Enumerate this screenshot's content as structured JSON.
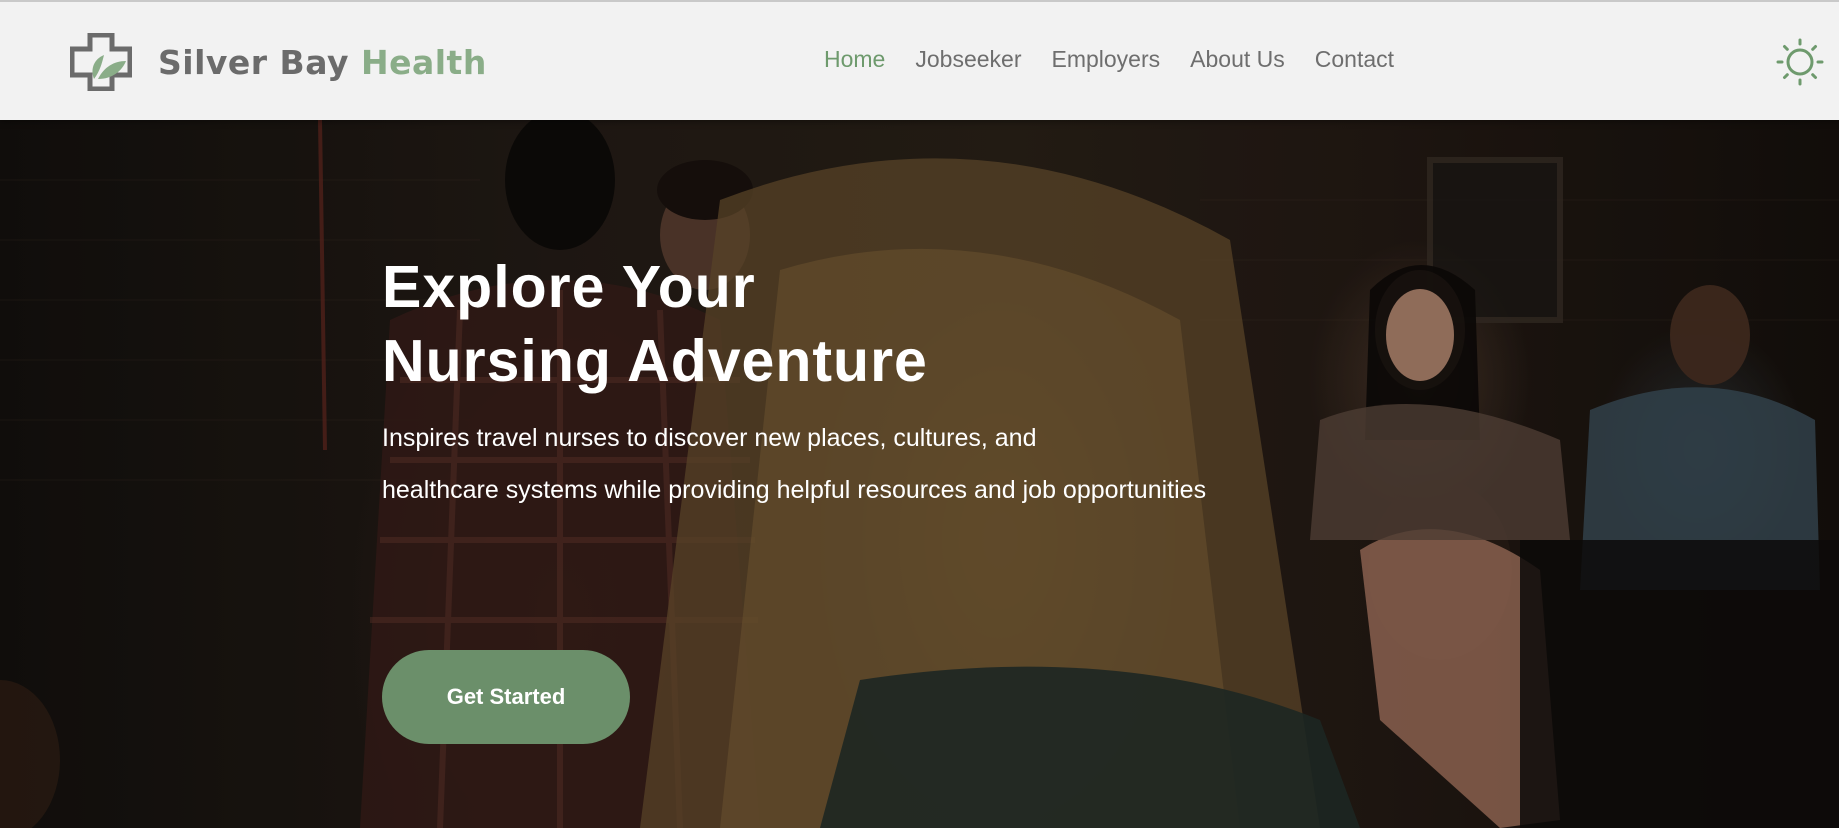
{
  "brand": {
    "name_part1": "Silver Bay",
    "name_part2": "Health",
    "logo_icon": "medical-cross-leaf-icon",
    "color_primary": "#6b8f6a",
    "color_accent_text": "#8aad88",
    "color_text_gray": "#6b6b6b"
  },
  "nav": {
    "items": [
      {
        "label": "Home",
        "active": true
      },
      {
        "label": "Jobseeker",
        "active": false
      },
      {
        "label": "Employers",
        "active": false
      },
      {
        "label": "About Us",
        "active": false
      },
      {
        "label": "Contact",
        "active": false
      }
    ],
    "theme_toggle_icon": "sun-icon"
  },
  "hero": {
    "title_line1": "Explore Your",
    "title_line2": "Nursing Adventure",
    "subtitle_line1": "Inspires travel nurses to discover new places, cultures, and",
    "subtitle_line2": "healthcare systems while providing helpful resources and job opportunities",
    "cta_label": "Get Started"
  }
}
